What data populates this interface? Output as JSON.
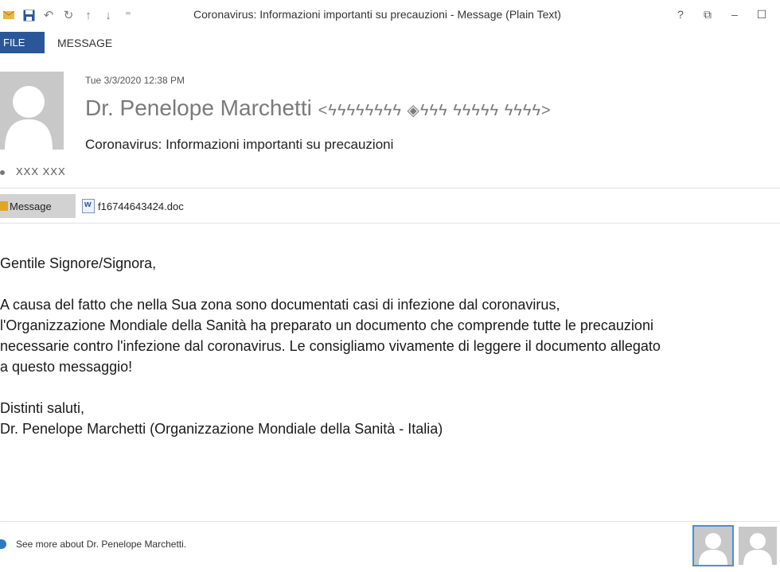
{
  "window": {
    "title": "Coronavirus: Informazioni importanti su precauzioni - Message (Plain Text)",
    "controls": {
      "help": "?",
      "restore": "⧉",
      "minimize": "–",
      "maximize": "☐"
    }
  },
  "qat": {
    "icons": [
      "envelope-icon",
      "save-icon",
      "undo-icon",
      "redo-icon",
      "up-arrow-icon",
      "down-arrow-icon",
      "customize-icon"
    ],
    "glyphs": {
      "undo": "↶",
      "redo": "↻",
      "up": "↑",
      "down": "↓",
      "more": "⁼"
    }
  },
  "ribbon": {
    "file_tab": "FILE",
    "message_tab": "MESSAGE"
  },
  "header": {
    "date": "Tue 3/3/2020 12:38 PM",
    "sender_name": "Dr. Penelope Marchetti",
    "sender_email": "<ϟϟϟϟϟϟϟϟ ◈ϟϟϟ ϟϟϟϟϟ ϟϟϟϟ>",
    "subject": "Coronavirus: Informazioni importanti su precauzioni",
    "recipient": "XXX XXX"
  },
  "attachments": {
    "message_label": "Message",
    "file_name": "f16744643424.doc"
  },
  "body": {
    "greeting": "Gentile Signore/Signora,",
    "paragraph": "A causa del fatto che nella Sua zona sono documentati casi di infezione dal coronavirus,\nl'Organizzazione Mondiale della Sanità ha preparato un documento che comprende tutte le precauzioni\nnecessarie contro l'infezione dal coronavirus. Le consigliamo vivamente di leggere il documento allegato\na questo messaggio!",
    "closing": "Distinti saluti,\nDr. Penelope Marchetti (Organizzazione Mondiale della Sanità - Italia)"
  },
  "footer": {
    "see_more": "See more about Dr. Penelope Marchetti."
  },
  "colors": {
    "accent": "#2b579a",
    "attachment_bg": "#d2d2d2",
    "avatar_bg": "#c8c8c8",
    "selected_border": "#4a8fd3"
  }
}
